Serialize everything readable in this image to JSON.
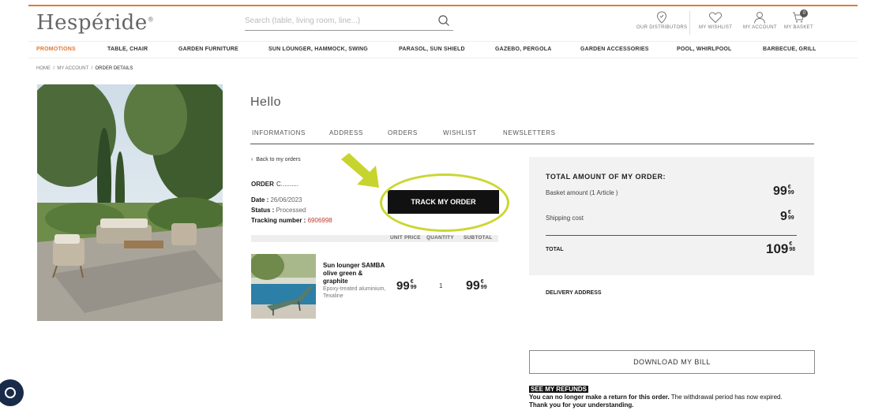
{
  "header": {
    "logo": "Hespéride",
    "logo_mark": "®",
    "search_placeholder": "Search (table, living room, line...)",
    "distributors": "OUR DISTRIBUTORS",
    "wishlist": "MY WISHLIST",
    "account": "MY ACCOUNT",
    "basket": "MY BASKET",
    "basket_count": "0"
  },
  "nav": [
    "PROMOTIONS",
    "TABLE, CHAIR",
    "GARDEN FURNITURE",
    "SUN LOUNGER, HAMMOCK, SWING",
    "PARASOL, SUN SHIELD",
    "GAZEBO, PERGOLA",
    "GARDEN ACCESSORIES",
    "POOL, WHIRLPOOL",
    "BARBECUE, GRILL"
  ],
  "breadcrumb": {
    "home": "HOME",
    "account": "MY ACCOUNT",
    "current": "ORDER DETAILS",
    "sep": "/"
  },
  "account": {
    "greeting": "Hello",
    "tabs": [
      "INFORMATIONS",
      "ADDRESS",
      "ORDERS",
      "WISHLIST",
      "NEWSLETTERS"
    ]
  },
  "order": {
    "back": "Back to my orders",
    "label": "ORDER",
    "number": "C..........",
    "date_label": "Date :",
    "date": "26/06/2023",
    "status_label": "Status :",
    "status": "Processed",
    "tracking_label": "Tracking number :",
    "tracking": "6906998",
    "track_button": "TRACK MY ORDER",
    "columns": [
      "UNIT PRICE",
      "QUANTITY",
      "SUBTOTAL"
    ],
    "item": {
      "name": "Sun lounger SAMBA olive green & graphite",
      "desc": "Epoxy-treated aluminium, Texaline",
      "unit_int": "99",
      "unit_cur": "€",
      "unit_dec": "99",
      "qty": "1",
      "sub_int": "99",
      "sub_cur": "€",
      "sub_dec": "99"
    }
  },
  "summary": {
    "title": "TOTAL AMOUNT OF MY ORDER:",
    "basket_label": "Basket amount (1 Article )",
    "basket_int": "99",
    "basket_cur": "€",
    "basket_dec": "99",
    "shipping_label": "Shipping cost",
    "ship_int": "9",
    "ship_cur": "€",
    "ship_dec": "99",
    "total_label": "TOTAL",
    "total_int": "109",
    "total_cur": "€",
    "total_dec": "98"
  },
  "delivery": "DELIVERY ADDRESS",
  "download": "DOWNLOAD MY BILL",
  "refunds": {
    "title": "SEE MY REFUNDS",
    "bold": "You can no longer make a return for this order.",
    "normal": " The withdrawal period has now expired.",
    "thanks": "Thank you for your understanding."
  },
  "colors": {
    "accent": "#e07a3b",
    "highlight": "#cbd632",
    "button": "#111111"
  }
}
